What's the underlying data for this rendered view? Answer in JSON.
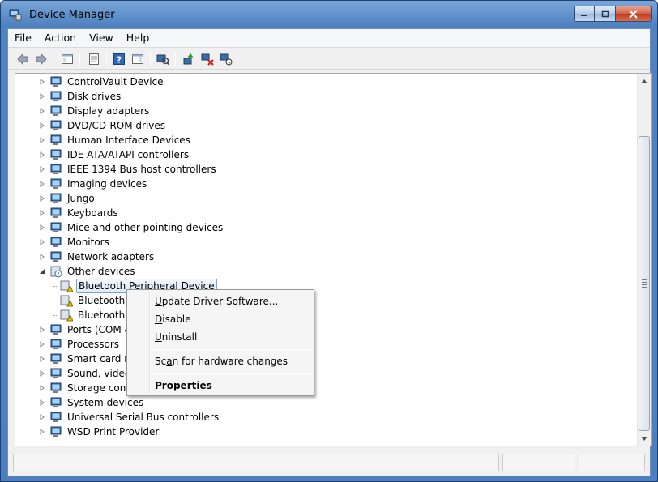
{
  "window": {
    "title": "Device Manager",
    "controls": {
      "minimize": "minimize-icon",
      "maximize": "maximize-icon",
      "close": "close-icon"
    }
  },
  "menubar": [
    "File",
    "Action",
    "View",
    "Help"
  ],
  "toolbar": {
    "buttons": [
      "back-arrow-icon",
      "forward-arrow-icon",
      "show-hide-console-tree-icon",
      "properties-icon",
      "help-icon",
      "action-pane-icon",
      "scan-hardware-icon",
      "update-driver-icon",
      "uninstall-icon",
      "disable-icon"
    ]
  },
  "tree": {
    "items": [
      {
        "label": "ControlVault Device",
        "expanded": false,
        "icon": "controlvault-icon"
      },
      {
        "label": "Disk drives",
        "expanded": false,
        "icon": "disk-drive-icon"
      },
      {
        "label": "Display adapters",
        "expanded": false,
        "icon": "display-adapter-icon"
      },
      {
        "label": "DVD/CD-ROM drives",
        "expanded": false,
        "icon": "dvd-drive-icon"
      },
      {
        "label": "Human Interface Devices",
        "expanded": false,
        "icon": "hid-icon"
      },
      {
        "label": "IDE ATA/ATAPI controllers",
        "expanded": false,
        "icon": "ide-controller-icon"
      },
      {
        "label": "IEEE 1394 Bus host controllers",
        "expanded": false,
        "icon": "ieee1394-icon"
      },
      {
        "label": "Imaging devices",
        "expanded": false,
        "icon": "imaging-device-icon"
      },
      {
        "label": "Jungo",
        "expanded": false,
        "icon": "jungo-icon"
      },
      {
        "label": "Keyboards",
        "expanded": false,
        "icon": "keyboard-icon"
      },
      {
        "label": "Mice and other pointing devices",
        "expanded": false,
        "icon": "mouse-icon"
      },
      {
        "label": "Monitors",
        "expanded": false,
        "icon": "monitor-icon"
      },
      {
        "label": "Network adapters",
        "expanded": false,
        "icon": "network-adapter-icon"
      },
      {
        "label": "Other devices",
        "expanded": true,
        "icon": "other-devices-icon"
      },
      {
        "label": "Bluetooth Peripheral Device",
        "child": true,
        "selected": true,
        "icon": "warning-device-icon"
      },
      {
        "label": "Bluetooth I",
        "child": true,
        "icon": "warning-device-icon"
      },
      {
        "label": "Bluetooth I",
        "child": true,
        "icon": "warning-device-icon"
      },
      {
        "label": "Ports (COM &",
        "expanded": false,
        "icon": "port-icon"
      },
      {
        "label": "Processors",
        "expanded": false,
        "icon": "processor-icon"
      },
      {
        "label": "Smart card rea",
        "expanded": false,
        "icon": "smart-card-icon"
      },
      {
        "label": "Sound, video a",
        "expanded": false,
        "icon": "sound-icon"
      },
      {
        "label": "Storage contro",
        "expanded": false,
        "icon": "storage-controller-icon"
      },
      {
        "label": "System devices",
        "expanded": false,
        "icon": "system-device-icon"
      },
      {
        "label": "Universal Serial Bus controllers",
        "expanded": false,
        "icon": "usb-icon"
      },
      {
        "label": "WSD Print Provider",
        "expanded": false,
        "icon": "printer-icon"
      }
    ]
  },
  "context_menu": {
    "update": {
      "pre": "",
      "key": "U",
      "post": "pdate Driver Software..."
    },
    "disable": {
      "pre": "",
      "key": "D",
      "post": "isable"
    },
    "uninstall": {
      "pre": "",
      "key": "U",
      "post": "ninstall"
    },
    "scan": {
      "pre": "Sc",
      "key": "a",
      "post": "n for hardware changes"
    },
    "properties": {
      "pre": "",
      "key": "P",
      "post": "roperties"
    }
  },
  "colors": {
    "titlebar": "#5a8cc8",
    "selection_border": "#7da2ce",
    "warning": "#f2c200"
  }
}
